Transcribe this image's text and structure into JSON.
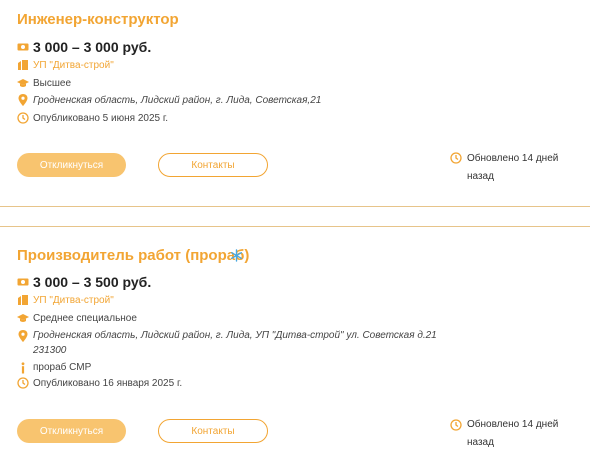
{
  "colors": {
    "accent": "#f2a533",
    "button_fill": "#f8c46f",
    "divider": "#e7c48a"
  },
  "vacancies": [
    {
      "title": "Инженер-конструктор",
      "salary": "3 000 – 3 000 руб.",
      "company": "УП \"Дитва-строй\"",
      "education": "Высшее",
      "address_lines": [
        "Гродненская область, Лидский район, г. Лида, Советская,21"
      ],
      "published": "Опубликовано 5 июня 2025 г.",
      "apply_label": "Откликнуться",
      "contacts_label": "Контакты",
      "updated_line1": "Обновлено 14 дней",
      "updated_line2": "назад"
    },
    {
      "title": "Производитель работ (прораб)",
      "salary": "3 000 – 3 500 руб.",
      "company": "УП \"Дитва-строй\"",
      "education": "Среднее специальное",
      "address_lines": [
        "Гродненская область, Лидский район, г. Лида, УП \"Дитва-строй\" ул. Советская д.21",
        "231300"
      ],
      "info": "прораб СМР",
      "published": "Опубликовано 16 января 2025 г.",
      "apply_label": "Откликнуться",
      "contacts_label": "Контакты",
      "updated_line1": "Обновлено 14 дней",
      "updated_line2": "назад"
    }
  ]
}
